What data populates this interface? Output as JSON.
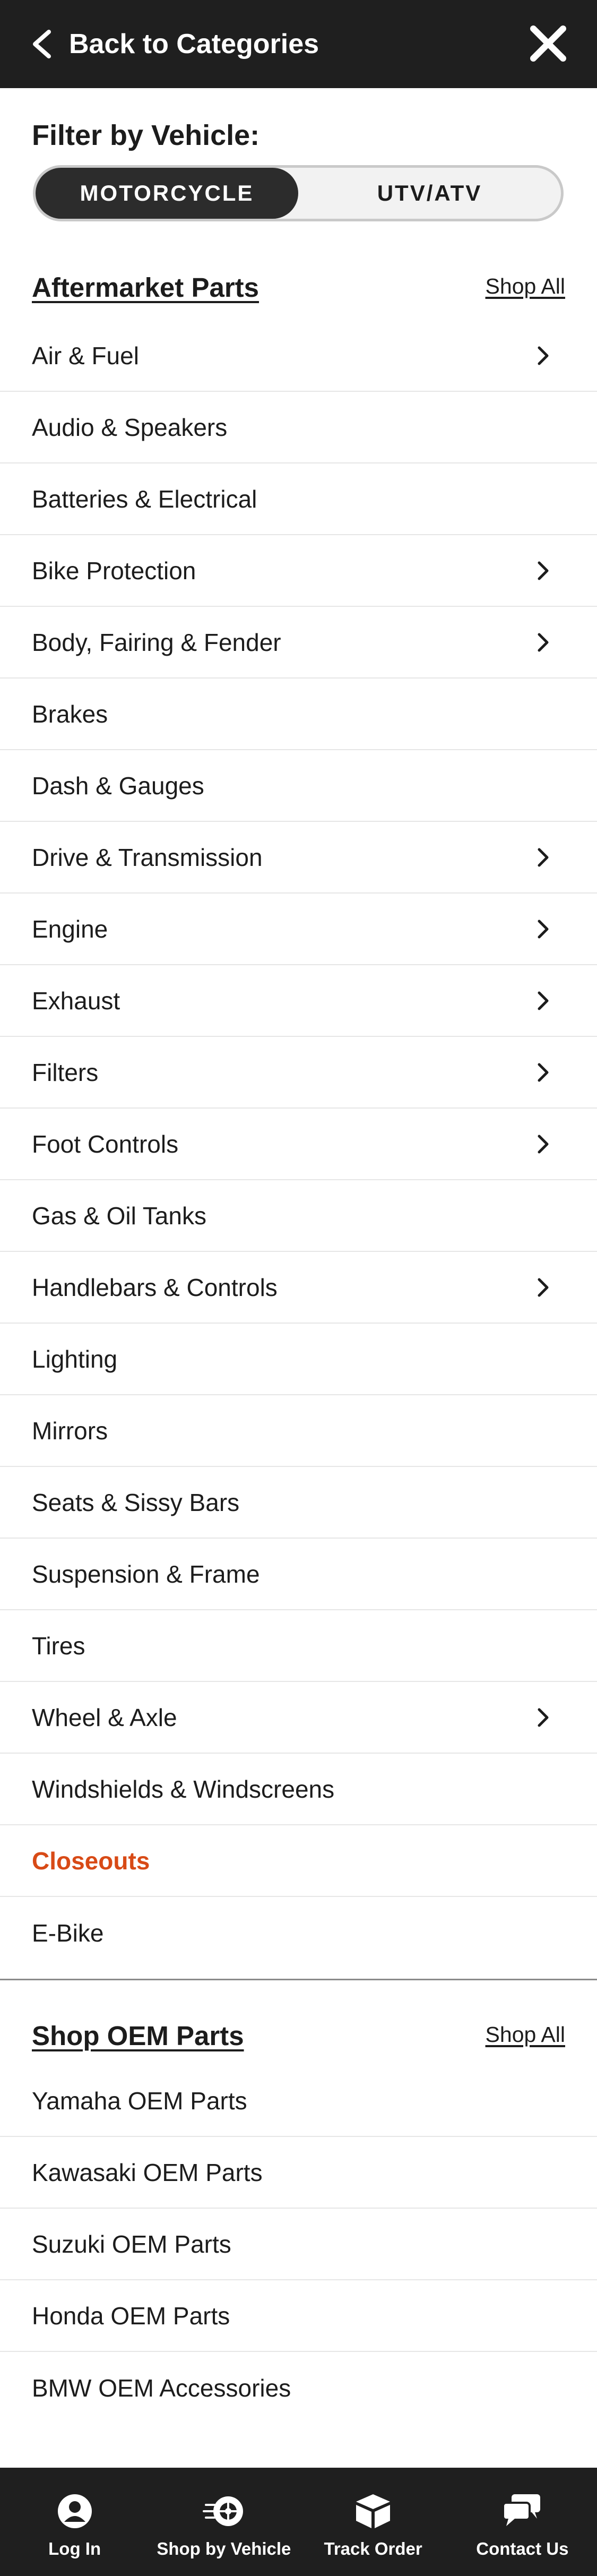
{
  "header": {
    "back_label": "Back to Categories"
  },
  "filter": {
    "title": "Filter by Vehicle:",
    "options": [
      "MOTORCYCLE",
      "UTV/ATV"
    ],
    "selected": "MOTORCYCLE"
  },
  "aftermarket": {
    "title": "Aftermarket Parts",
    "shop_all": "Shop All",
    "items": [
      {
        "label": "Air & Fuel",
        "has_children": true
      },
      {
        "label": "Audio & Speakers",
        "has_children": false
      },
      {
        "label": "Batteries & Electrical",
        "has_children": false
      },
      {
        "label": "Bike Protection",
        "has_children": true
      },
      {
        "label": "Body, Fairing & Fender",
        "has_children": true
      },
      {
        "label": "Brakes",
        "has_children": false
      },
      {
        "label": "Dash & Gauges",
        "has_children": false
      },
      {
        "label": "Drive & Transmission",
        "has_children": true
      },
      {
        "label": "Engine",
        "has_children": true
      },
      {
        "label": "Exhaust",
        "has_children": true
      },
      {
        "label": "Filters",
        "has_children": true
      },
      {
        "label": "Foot Controls",
        "has_children": true
      },
      {
        "label": "Gas & Oil Tanks",
        "has_children": false
      },
      {
        "label": "Handlebars & Controls",
        "has_children": true
      },
      {
        "label": "Lighting",
        "has_children": false
      },
      {
        "label": "Mirrors",
        "has_children": false
      },
      {
        "label": "Seats & Sissy Bars",
        "has_children": false
      },
      {
        "label": "Suspension & Frame",
        "has_children": false
      },
      {
        "label": "Tires",
        "has_children": false
      },
      {
        "label": "Wheel & Axle",
        "has_children": true
      },
      {
        "label": "Windshields & Windscreens",
        "has_children": false
      },
      {
        "label": "Closeouts",
        "has_children": false,
        "accent": true
      },
      {
        "label": "E-Bike",
        "has_children": false
      }
    ]
  },
  "oem": {
    "title": "Shop OEM Parts",
    "shop_all": "Shop All",
    "items": [
      {
        "label": "Yamaha OEM Parts"
      },
      {
        "label": "Kawasaki OEM Parts"
      },
      {
        "label": "Suzuki OEM Parts"
      },
      {
        "label": "Honda OEM Parts"
      },
      {
        "label": "BMW OEM Accessories"
      }
    ]
  },
  "bottom_nav": [
    {
      "label": "Log In",
      "icon": "user-icon"
    },
    {
      "label": "Shop by Vehicle",
      "icon": "wheel-icon"
    },
    {
      "label": "Track Order",
      "icon": "box-icon"
    },
    {
      "label": "Contact Us",
      "icon": "chat-icon"
    }
  ],
  "colors": {
    "header_bg": "#1f1f1f",
    "accent": "#d84a16",
    "toggle_active": "#2c2c2c"
  }
}
